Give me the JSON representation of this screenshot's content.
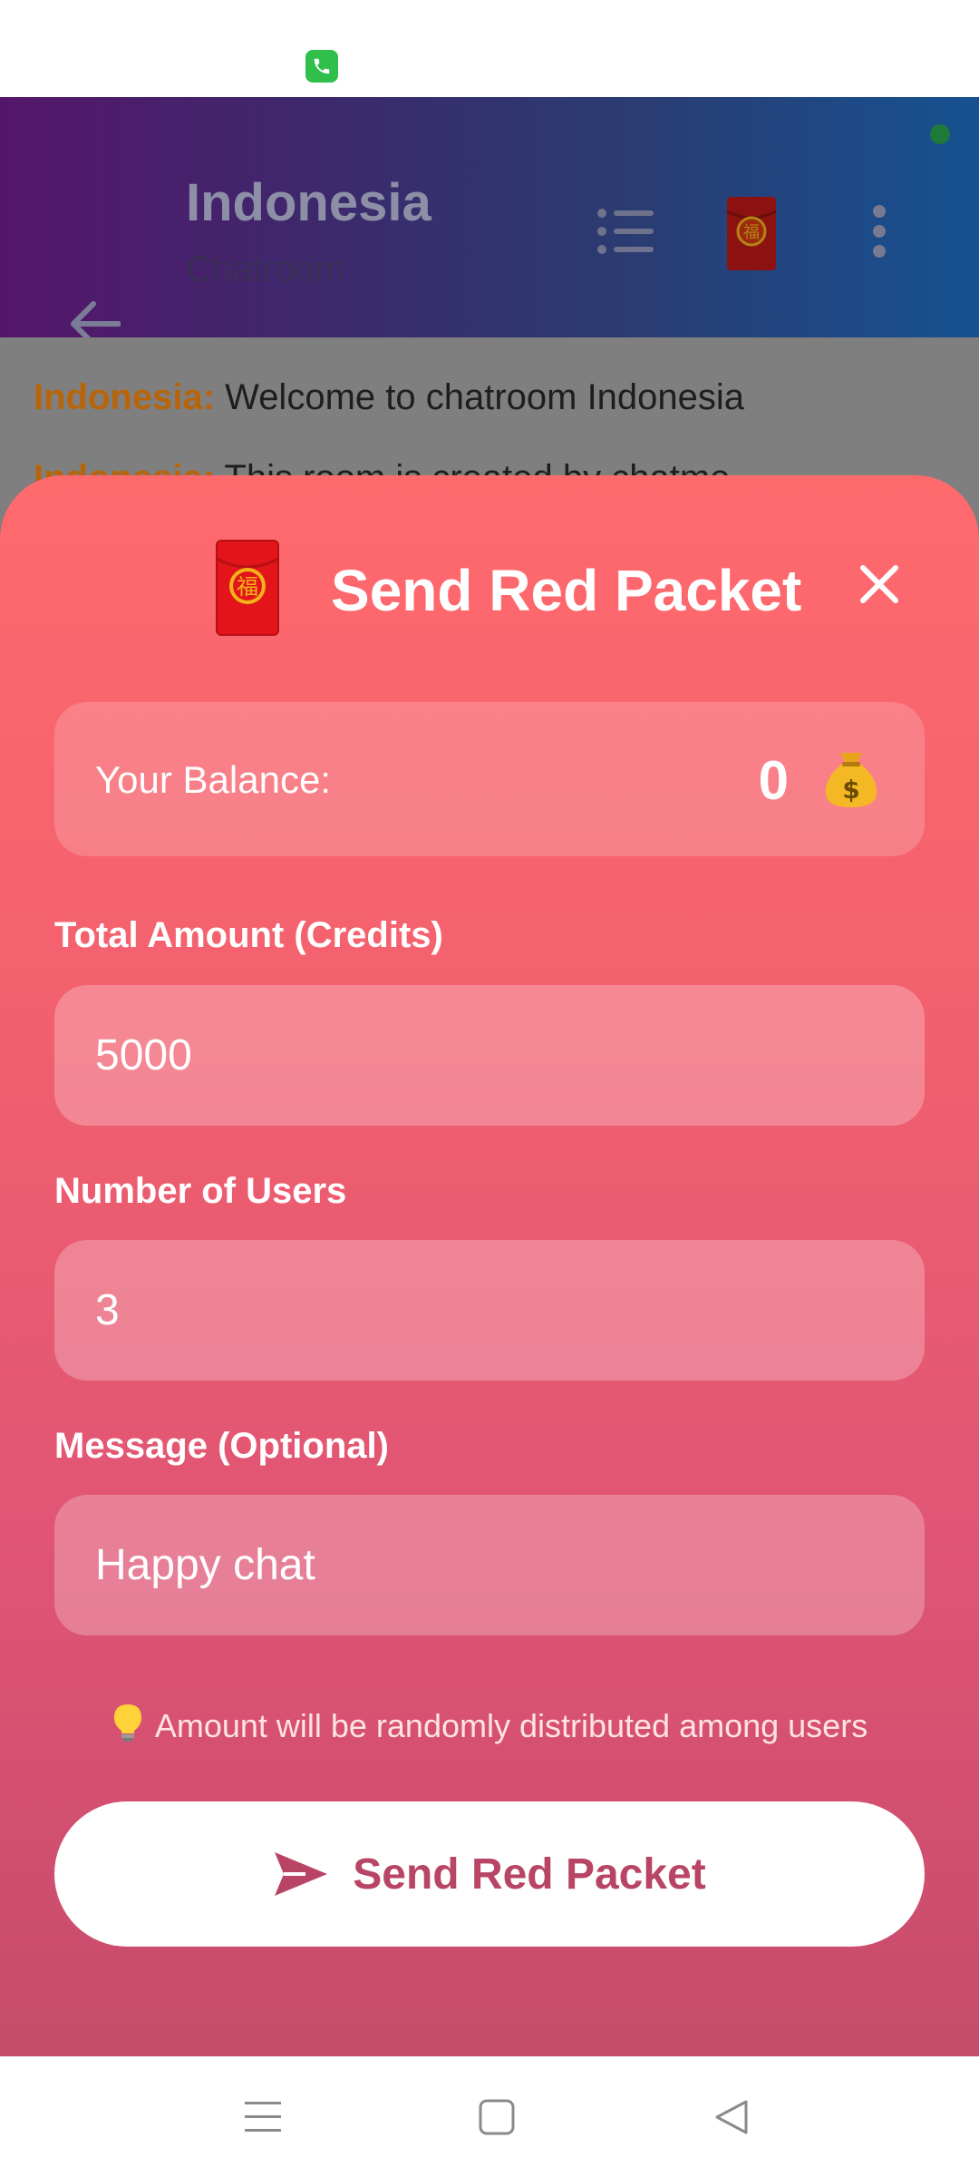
{
  "header": {
    "title": "Indonesia",
    "subtitle": "Chatroom"
  },
  "chat": {
    "messages": [
      {
        "sender": "Indonesia:",
        "text": "Welcome to chatroom Indonesia"
      },
      {
        "sender": "Indonesia:",
        "text": "This room is created by chatme"
      }
    ]
  },
  "sheet": {
    "title": "Send Red Packet",
    "balance_label": "Your Balance:",
    "balance_value": "0",
    "total_amount_label": "Total Amount (Credits)",
    "total_amount_value": "5000",
    "users_label": "Number of Users",
    "users_value": "3",
    "message_label": "Message (Optional)",
    "message_value": "Happy chat",
    "hint": "Amount will be randomly distributed among users",
    "send_label": "Send Red Packet"
  },
  "icons": {
    "envelope_glyph": "福",
    "hint_icon": "lightbulb-icon",
    "balance_icon": "money-bag-icon"
  },
  "colors": {
    "sheet_top": "#ff6a6d",
    "sheet_bottom": "#c64b6b",
    "accent_text": "#b94566",
    "sender_color": "#b8650a",
    "call_green": "#2fbf4a"
  }
}
